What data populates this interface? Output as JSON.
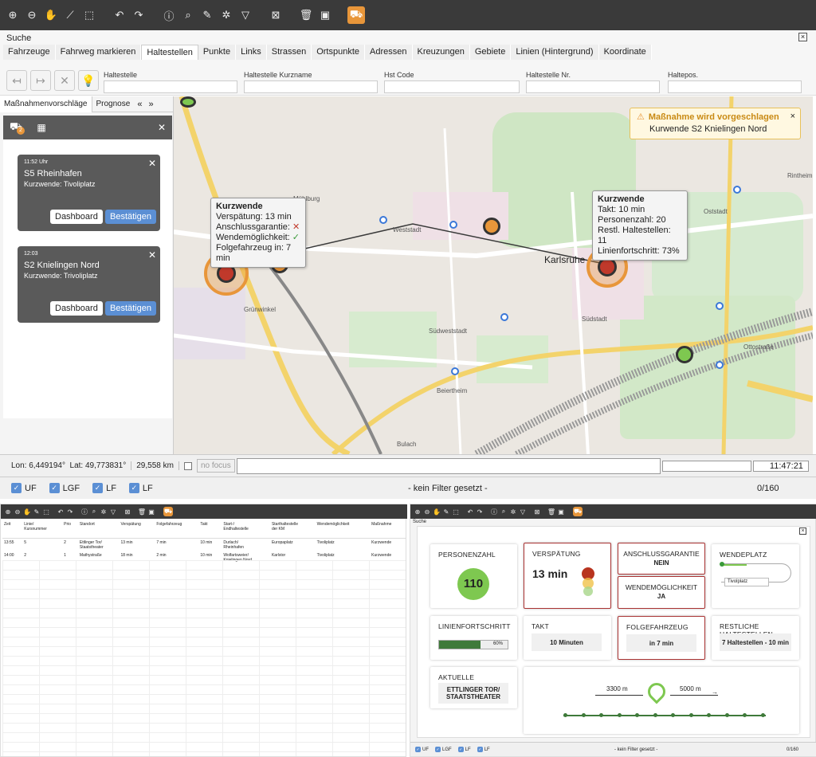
{
  "top": {
    "toolbar_icons": [
      "zoom-in-icon",
      "zoom-out-icon",
      "pan-hand-icon",
      "ruler-icon",
      "select-rect-icon",
      "undo-icon",
      "redo-icon",
      "info-icon",
      "search-icon",
      "pencil-icon",
      "settings-icon",
      "filter-icon",
      "layers-icon",
      "trash-icon",
      "bus-icon",
      "buses-icon"
    ],
    "search_panel": {
      "title": "Suche",
      "tabs": [
        "Fahrzeuge",
        "Fahrweg markieren",
        "Haltestellen",
        "Punkte",
        "Links",
        "Strassen",
        "Ortspunkte",
        "Adressen",
        "Kreuzungen",
        "Gebiete",
        "Linien (Hintergrund)",
        "Koordinate"
      ],
      "active_tab": "Haltestellen",
      "fields": [
        "Haltestelle",
        "Haltestelle Kurzname",
        "Hst Code",
        "Haltestelle Nr.",
        "Haltepos."
      ]
    },
    "left_panel": {
      "tabs": [
        "Maßnahmenvorschläge",
        "Prognose"
      ],
      "badge": "2",
      "cards": [
        {
          "time": "11:52 Uhr",
          "title": "S5 Rheinhafen",
          "subtitle": "Kurzwende: Tivoliplatz",
          "btn1": "Dashboard",
          "btn2": "Bestätigen"
        },
        {
          "time": "12:03",
          "title": "S2 Knielingen Nord",
          "subtitle": "Kurzwende: Trivoliplatz",
          "btn1": "Dashboard",
          "btn2": "Bestätigen"
        }
      ]
    },
    "map": {
      "labels": [
        "Mühlburg",
        "Weststadt",
        "Karlsruhe",
        "Grünwinkel",
        "Südweststadt",
        "Südstadt",
        "Beiertheim",
        "Bulach",
        "Oststadt",
        "Rintheim",
        "Ottostraße"
      ],
      "popup1": {
        "title": "Kurzwende",
        "lines": [
          "Verspätung: 13 min",
          "Anschlussgarantie:",
          "Wendemöglichkeit:",
          "Folgefahrzeug in: 7 min"
        ]
      },
      "popup2": {
        "title": "Kurzwende",
        "lines": [
          "Takt: 10 min",
          "Personenzahl: 20",
          "Restl. Haltestellen: 11",
          "Linienfortschritt: 73%"
        ]
      },
      "alert": {
        "title": "Maßnahme wird vorgeschlagen",
        "text": "Kurwende S2 Knielingen Nord"
      }
    },
    "statusbar": {
      "coords": "Lon: 6,449194°  Lat: 49,773831°",
      "distance": "29,558 km",
      "focus": "no focus",
      "time": "11:47:21"
    },
    "filterbar": {
      "checks": [
        "UF",
        "LGF",
        "LF",
        "LF"
      ],
      "filter": "- kein Filter gesetzt -",
      "count": "0/160"
    }
  },
  "bottom_left": {
    "headers": [
      "Zeit",
      "Linie/\nKursnummer",
      "Prio",
      "Standort",
      "Verspätung",
      "Folgefahrzeug",
      "Takt",
      "Start-/\nEndhaltestelle",
      "Starthaltestelle\nder KM",
      "Wendemöglichkeit",
      "Maßnahme"
    ],
    "rows": [
      [
        "13:55",
        "5",
        "2",
        "Ettlinger Tor/\nStaatstheater",
        "13 min",
        "7 min",
        "10 min",
        "Durlach/\nRheinhafen",
        "Europaplatz",
        "Tivoliplatz",
        "Kurzwende"
      ],
      [
        "14:00",
        "2",
        "1",
        "Mathystraße",
        "18 min",
        "2 min",
        "10 min",
        "Wolfartsweier/\nKnielingen Nord",
        "Karlstor",
        "Tivoliplatz",
        "Kurzwende"
      ]
    ]
  },
  "bottom_right": {
    "title": "Suche",
    "tiles": {
      "personen": {
        "title": "PERSONENZAHL",
        "value": "110"
      },
      "verspaetung": {
        "title": "VERSPÄTUNG",
        "value": "13 min"
      },
      "anschluss": {
        "title": "ANSCHLUSSGARANTIE",
        "value": "NEIN"
      },
      "wende_m": {
        "title": "WENDEMÖGLICHKEIT",
        "value": "JA"
      },
      "wendeplatz": {
        "title": "WENDEPLATZ",
        "value": "Tivolplatz"
      },
      "linien": {
        "title": "LINIENFORTSCHRITT",
        "value": "60%",
        "progress": 0.6
      },
      "takt": {
        "title": "TAKT",
        "value": "10 Minuten"
      },
      "folge": {
        "title": "FOLGEFAHRZEUG",
        "value": "in 7 min"
      },
      "rest": {
        "title": "RESTLICHE HALTESTELLEN",
        "value": "7 Haltestellen - 10 min"
      },
      "aktuell": {
        "title": "AKTUELLE HALTESTELLE",
        "value": "ETTLINGER TOR/\nSTAATSTHEATER"
      },
      "route": {
        "left": "3300 m",
        "right": "5000 m"
      }
    },
    "filterbar": {
      "checks": [
        "UF",
        "LGF",
        "LF",
        "LF"
      ],
      "filter": "- kein Filter gesetzt -",
      "count": "0/160"
    }
  },
  "colors": {
    "orange": "#e8963a",
    "blue": "#5b8fd4",
    "green": "#7ec850",
    "red": "#c0392b",
    "darkbar": "#3a3a3a"
  }
}
